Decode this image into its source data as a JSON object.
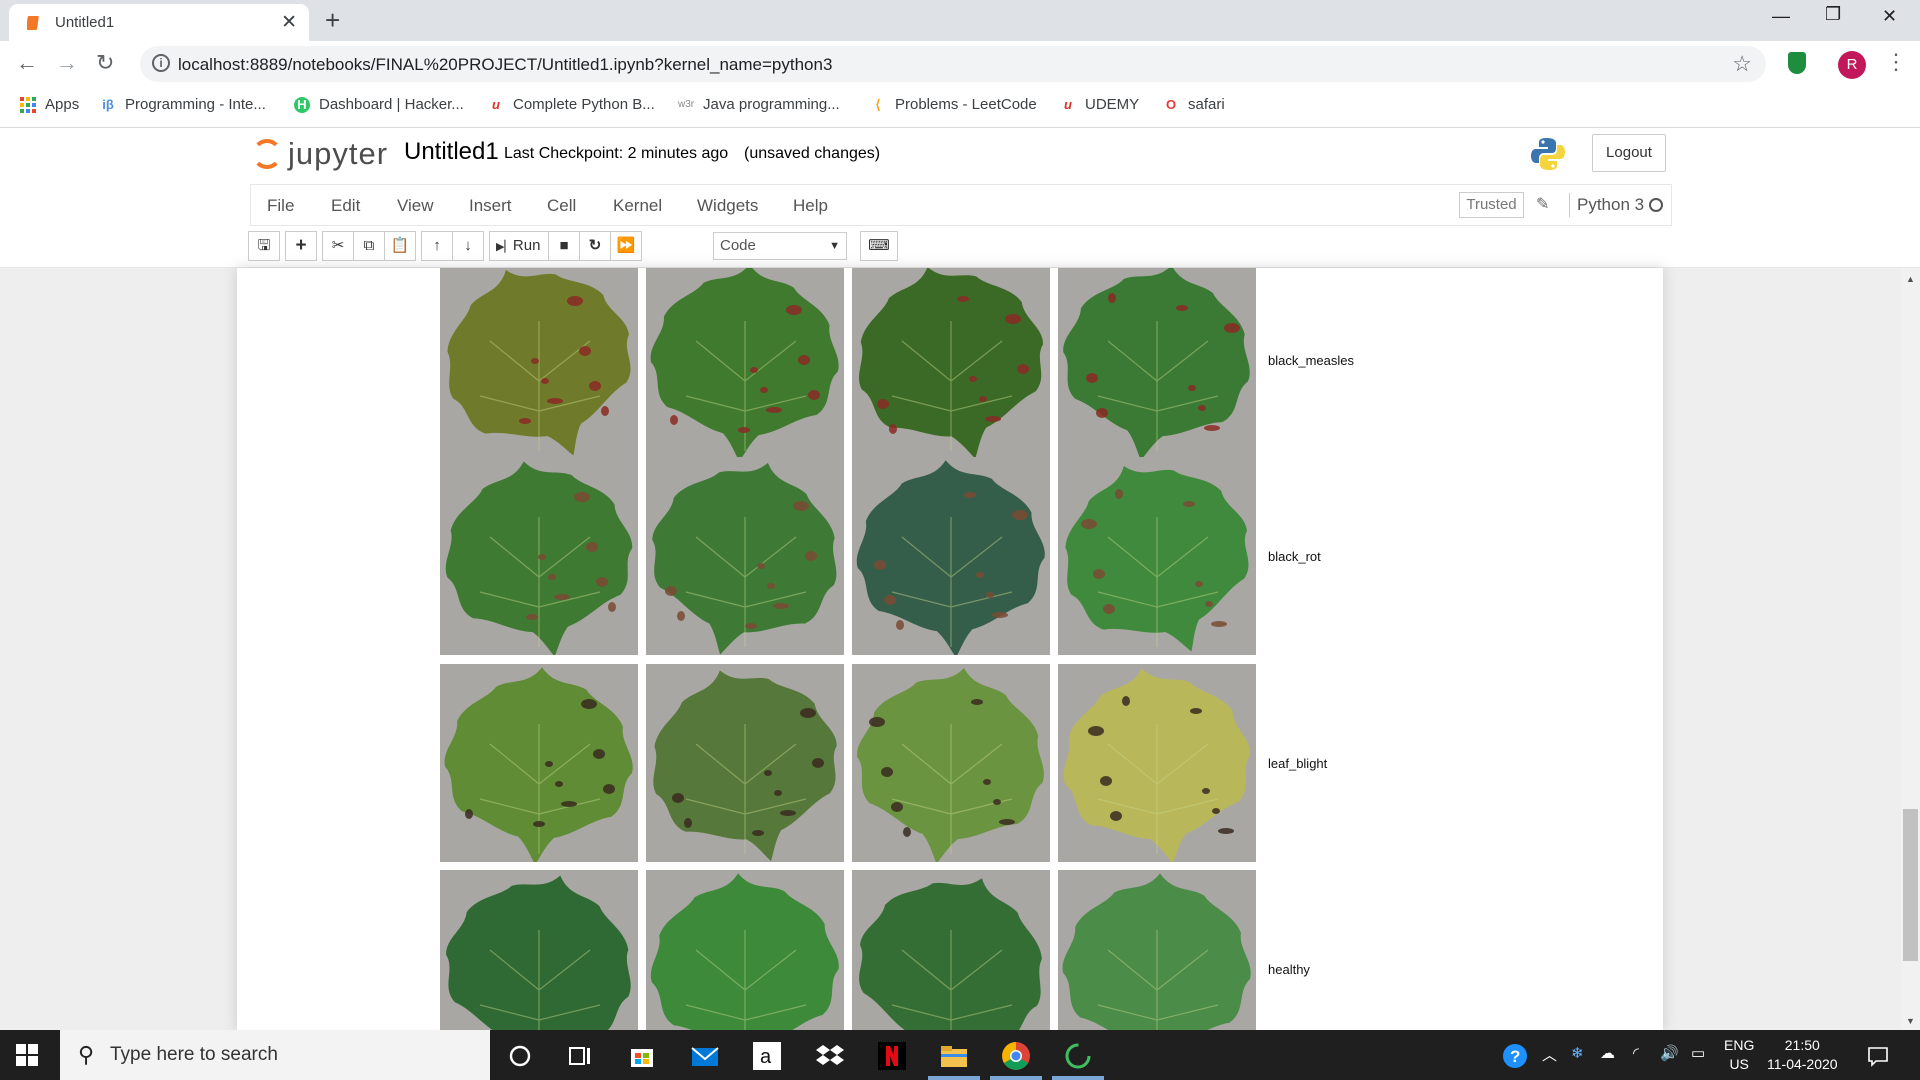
{
  "browser": {
    "tab_title": "Untitled1",
    "url": "localhost:8889/notebooks/FINAL%20PROJECT/Untitled1.ipynb?kernel_name=python3",
    "profile_initial": "R",
    "bookmarks": [
      {
        "label": "Apps",
        "icon": "apps-grid-icon",
        "color": "#ea4335"
      },
      {
        "label": "Programming - Inte...",
        "icon": "interviewbit-icon",
        "color": "#4a90d9"
      },
      {
        "label": "Dashboard | Hacker...",
        "icon": "hackerrank-icon",
        "color": "#2ec866"
      },
      {
        "label": "Complete Python B...",
        "icon": "udemy-icon",
        "color": "#e0322a"
      },
      {
        "label": "Java programming...",
        "icon": "w3r-icon",
        "color": "#888888"
      },
      {
        "label": "Problems - LeetCode",
        "icon": "leetcode-icon",
        "color": "#f89f1b"
      },
      {
        "label": "UDEMY",
        "icon": "udemy-icon",
        "color": "#e0322a"
      },
      {
        "label": "safari",
        "icon": "safari-icon",
        "color": "#e53935"
      }
    ]
  },
  "jupyter": {
    "logo_text": "jupyter",
    "notebook_name": "Untitled1",
    "checkpoint": "Last Checkpoint: 2 minutes ago",
    "save_status": "(unsaved changes)",
    "logout_label": "Logout",
    "menus": [
      "File",
      "Edit",
      "View",
      "Insert",
      "Cell",
      "Kernel",
      "Widgets",
      "Help"
    ],
    "trusted_label": "Trusted",
    "kernel_name": "Python 3",
    "run_label": "Run",
    "cell_type": "Code"
  },
  "output": {
    "rows": [
      {
        "label": "black_measles",
        "leaf_colors": [
          "#6f7a2a",
          "#3f7a2e",
          "#3b6a26",
          "#3a7a34"
        ],
        "spot_color": "#8a2a24"
      },
      {
        "label": "black_rot",
        "leaf_colors": [
          "#3f7a33",
          "#3e7a36",
          "#355e4a",
          "#3f8a3c"
        ],
        "spot_color": "#7a4a32"
      },
      {
        "label": "leaf_blight",
        "leaf_colors": [
          "#5f8c34",
          "#56783a",
          "#6a9440",
          "#b8b85a"
        ],
        "spot_color": "#3a2a20"
      },
      {
        "label": "healthy",
        "leaf_colors": [
          "#2f6a34",
          "#3c8a3a",
          "#356e35",
          "#4a8c48"
        ],
        "spot_color": ""
      }
    ]
  },
  "taskbar": {
    "search_placeholder": "Type here to search",
    "lang": "ENG",
    "region": "US",
    "time": "21:50",
    "date": "11-04-2020"
  }
}
